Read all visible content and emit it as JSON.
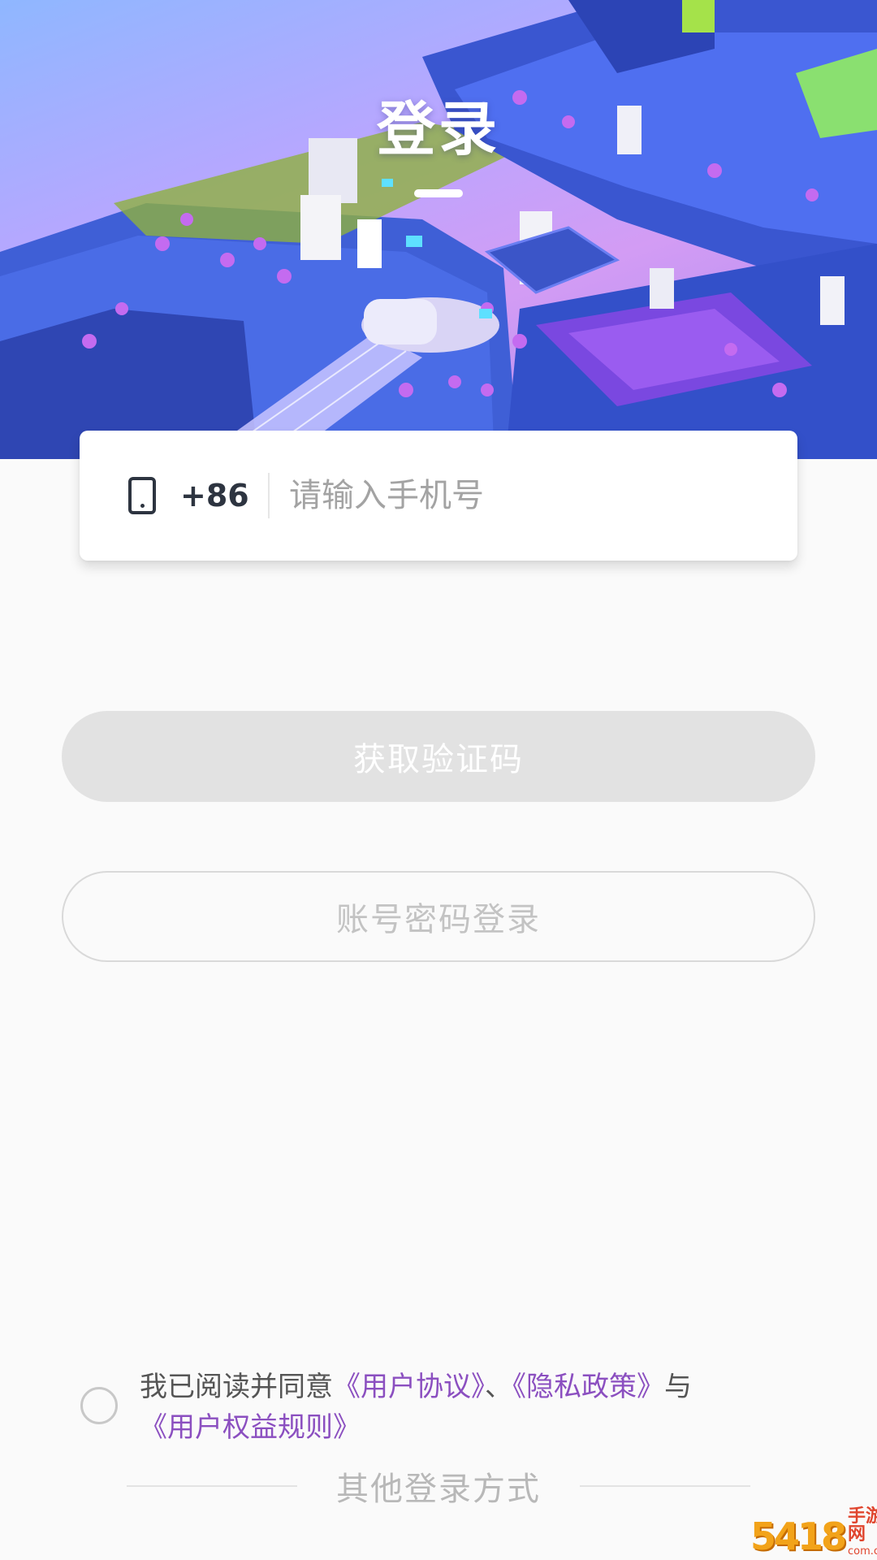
{
  "header": {
    "title": "登录"
  },
  "phone": {
    "country_code": "+86",
    "placeholder": "请输入手机号",
    "value": ""
  },
  "buttons": {
    "get_code": "获取验证码",
    "password_login": "账号密码登录"
  },
  "agreement": {
    "prefix": "我已阅读并同意",
    "user_agreement": "《用户协议》",
    "sep1": "、",
    "privacy_policy": "《隐私政策》",
    "sep2": "与",
    "rights_rules": "《用户权益规则》",
    "checked": false
  },
  "other_login": {
    "label": "其他登录方式"
  },
  "watermark": {
    "number": "5418",
    "text": "手游网",
    "url": "com.cn"
  },
  "colors": {
    "link": "#8b4fc0",
    "disabled_button": "#e2e2e2",
    "background": "#fafafa"
  }
}
